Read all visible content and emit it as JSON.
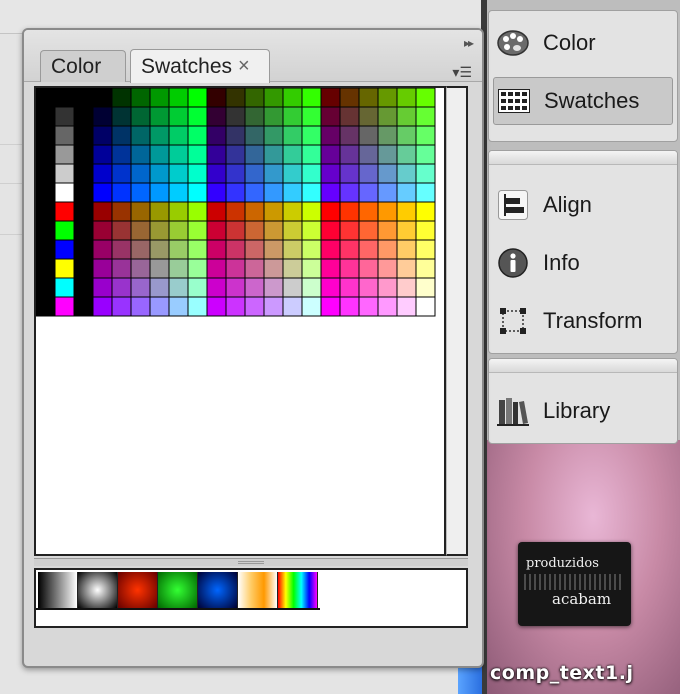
{
  "panel": {
    "tabs": [
      {
        "label": "Color",
        "active": false
      },
      {
        "label": "Swatches",
        "active": true
      }
    ],
    "close_glyph": "×",
    "collapse_glyph": "▸▸",
    "menu_glyph": "▾☰"
  },
  "dock": {
    "items": [
      {
        "label": "Color",
        "icon": "palette-icon",
        "active": false
      },
      {
        "label": "Swatches",
        "icon": "swatches-grid-icon",
        "active": true
      },
      {
        "label": "Align",
        "icon": "align-icon",
        "active": false
      },
      {
        "label": "Info",
        "icon": "info-icon",
        "active": false
      },
      {
        "label": "Transform",
        "icon": "transform-icon",
        "active": false
      },
      {
        "label": "Library",
        "icon": "library-icon",
        "active": false
      }
    ]
  },
  "swatches": {
    "grays": [
      "#000000",
      "#333333",
      "#666666",
      "#999999",
      "#cccccc",
      "#ffffff"
    ],
    "primaries": [
      "#ff0000",
      "#00ff00",
      "#0000ff",
      "#ffff00",
      "#00ffff",
      "#ff00ff"
    ]
  },
  "gradients": [
    {
      "name": "black-white-linear",
      "colors": [
        "#000000",
        "#ffffff"
      ]
    },
    {
      "name": "white-black-radial",
      "colors": [
        "#ffffff",
        "#000000"
      ]
    },
    {
      "name": "red-radial",
      "colors": [
        "#ff3300",
        "#660000"
      ]
    },
    {
      "name": "green-radial",
      "colors": [
        "#33ff33",
        "#006600"
      ]
    },
    {
      "name": "blue-radial",
      "colors": [
        "#0066ff",
        "#000033"
      ]
    },
    {
      "name": "gold-linear",
      "colors": [
        "#ffffff",
        "#ffcc66",
        "#ff9900",
        "#ffffff"
      ]
    },
    {
      "name": "rainbow-linear",
      "colors": [
        "#ff0000",
        "#ffff00",
        "#00ff00",
        "#00ffff",
        "#0000ff",
        "#ff00ff"
      ]
    }
  ],
  "desktop": {
    "file_label": "comp_text1.j",
    "thumbnail_words": [
      "produzidos",
      "acabam"
    ]
  }
}
